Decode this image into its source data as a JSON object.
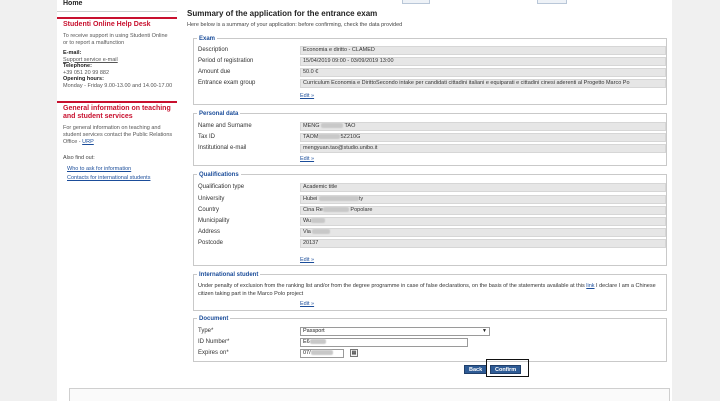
{
  "sidebar": {
    "home": "Home",
    "helpdesk": {
      "title": "Studenti Online Help Desk",
      "desc": "To receive support in using Studenti Online or to report a malfunction",
      "email_label": "E-mail:",
      "email_link": "Support service e-mail",
      "phone_label": "Telephone:",
      "phone": "+39 051 20 99 882",
      "hours_label": "Opening hours:",
      "hours": "Monday - Friday 9.00-13.00 and 14.00-17.00"
    },
    "general": {
      "title": "General information on teaching and student services",
      "desc_prefix": "For general information on teaching and student services contact the Public Relations Office - ",
      "urp_link": "URP"
    },
    "also_find": "Also find out:",
    "links": [
      "Who to ask for information",
      "Contacts for international students"
    ]
  },
  "main": {
    "title": "Summary of the application for the entrance exam",
    "intro": "Here below is a summary of your application: before confirming, check the data provided",
    "edit_label": "Edit »",
    "exam": {
      "legend": "Exam",
      "rows": [
        {
          "label": "Description",
          "value": "Economia e diritto - CLAMED"
        },
        {
          "label": "Period of registration",
          "value": "15/04/2019 09:00 - 03/09/2019 13:00"
        },
        {
          "label": "Amount due",
          "value": "50.0 €"
        },
        {
          "label": "Entrance exam group",
          "value": "Curriculum Economia e DirittoSecondo intake per candidati cittadini italiani e equiparati e cittadini cinesi aderenti al Progetto Marco Po"
        }
      ]
    },
    "personal": {
      "legend": "Personal data",
      "rows": [
        {
          "label": "Name and Surname",
          "value": "MENG",
          "value2": "TAO"
        },
        {
          "label": "Tax ID",
          "value": "TAOM",
          "value2": "5Z210G"
        },
        {
          "label": "Institutional e-mail",
          "value": "mengyuan.tao@studio.unibo.it"
        }
      ]
    },
    "qualifications": {
      "legend": "Qualifications",
      "rows": [
        {
          "label": "Qualification type",
          "value": "Academic title"
        },
        {
          "label": "University",
          "value": "Hubei",
          "value2": "ty"
        },
        {
          "label": "Country",
          "value": "Cina Re",
          "value2": "Popolare"
        },
        {
          "label": "Municipality",
          "value": "Wu"
        },
        {
          "label": "Address",
          "value": "Via"
        },
        {
          "label": "Postcode",
          "value": "20137"
        }
      ]
    },
    "international": {
      "legend": "International student",
      "text_before": "Under penalty of exclusion from the ranking list and/or from the degree programme in case of false declarations, on the basis of the statements available at this ",
      "link": "link",
      "text_after": " I declare I am a Chinese citizen taking part in the Marco Polo project"
    },
    "document": {
      "legend": "Document",
      "type_label": "Type*",
      "type_value": "Passport",
      "id_label": "ID Number*",
      "id_value": "E6",
      "expires_label": "Expires on*",
      "expires_value": "07/"
    },
    "buttons": {
      "back": "Back",
      "confirm": "Confirm"
    }
  }
}
